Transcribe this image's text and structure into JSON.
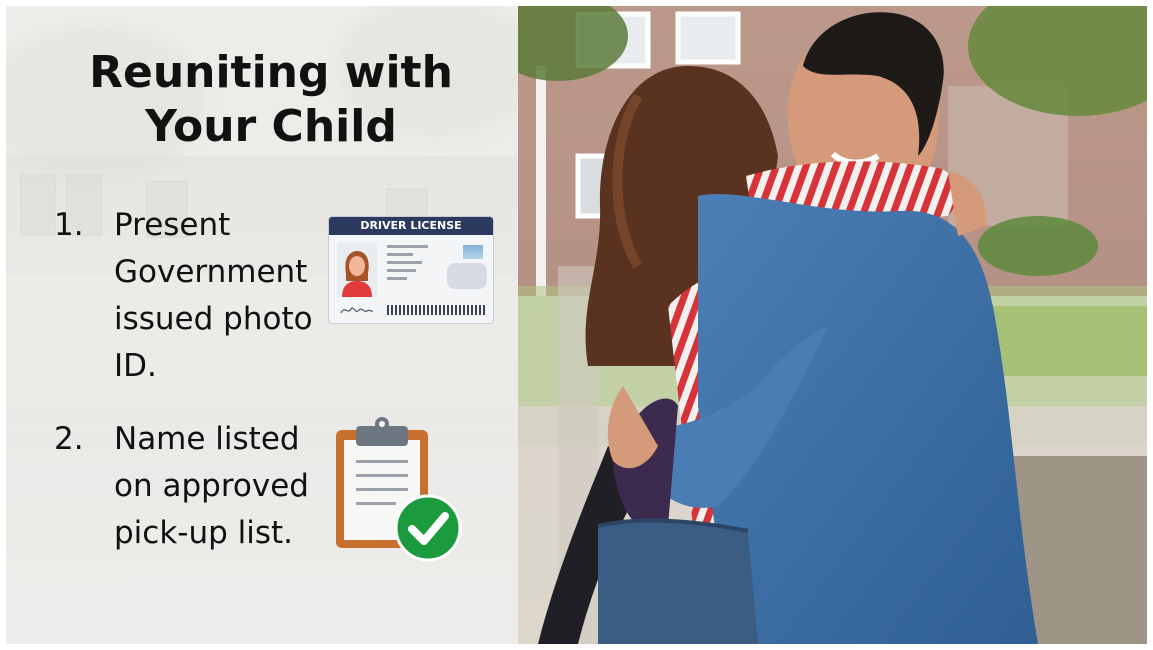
{
  "slide": {
    "title_line_1": "Reuniting with",
    "title_line_2": "Your Child"
  },
  "steps": [
    {
      "number": "1.",
      "text": "Present Government issued photo ID.",
      "icon": "driver-license-icon",
      "card_header": "DRIVER LICENSE"
    },
    {
      "number": "2.",
      "text": "Name listed on approved pick-up list.",
      "icon": "clipboard-check-icon"
    }
  ],
  "colors": {
    "card_header": "#2b3a5e",
    "clipboard_board": "#c8702f",
    "check_badge": "#1c9a3e",
    "text": "#111111"
  }
}
